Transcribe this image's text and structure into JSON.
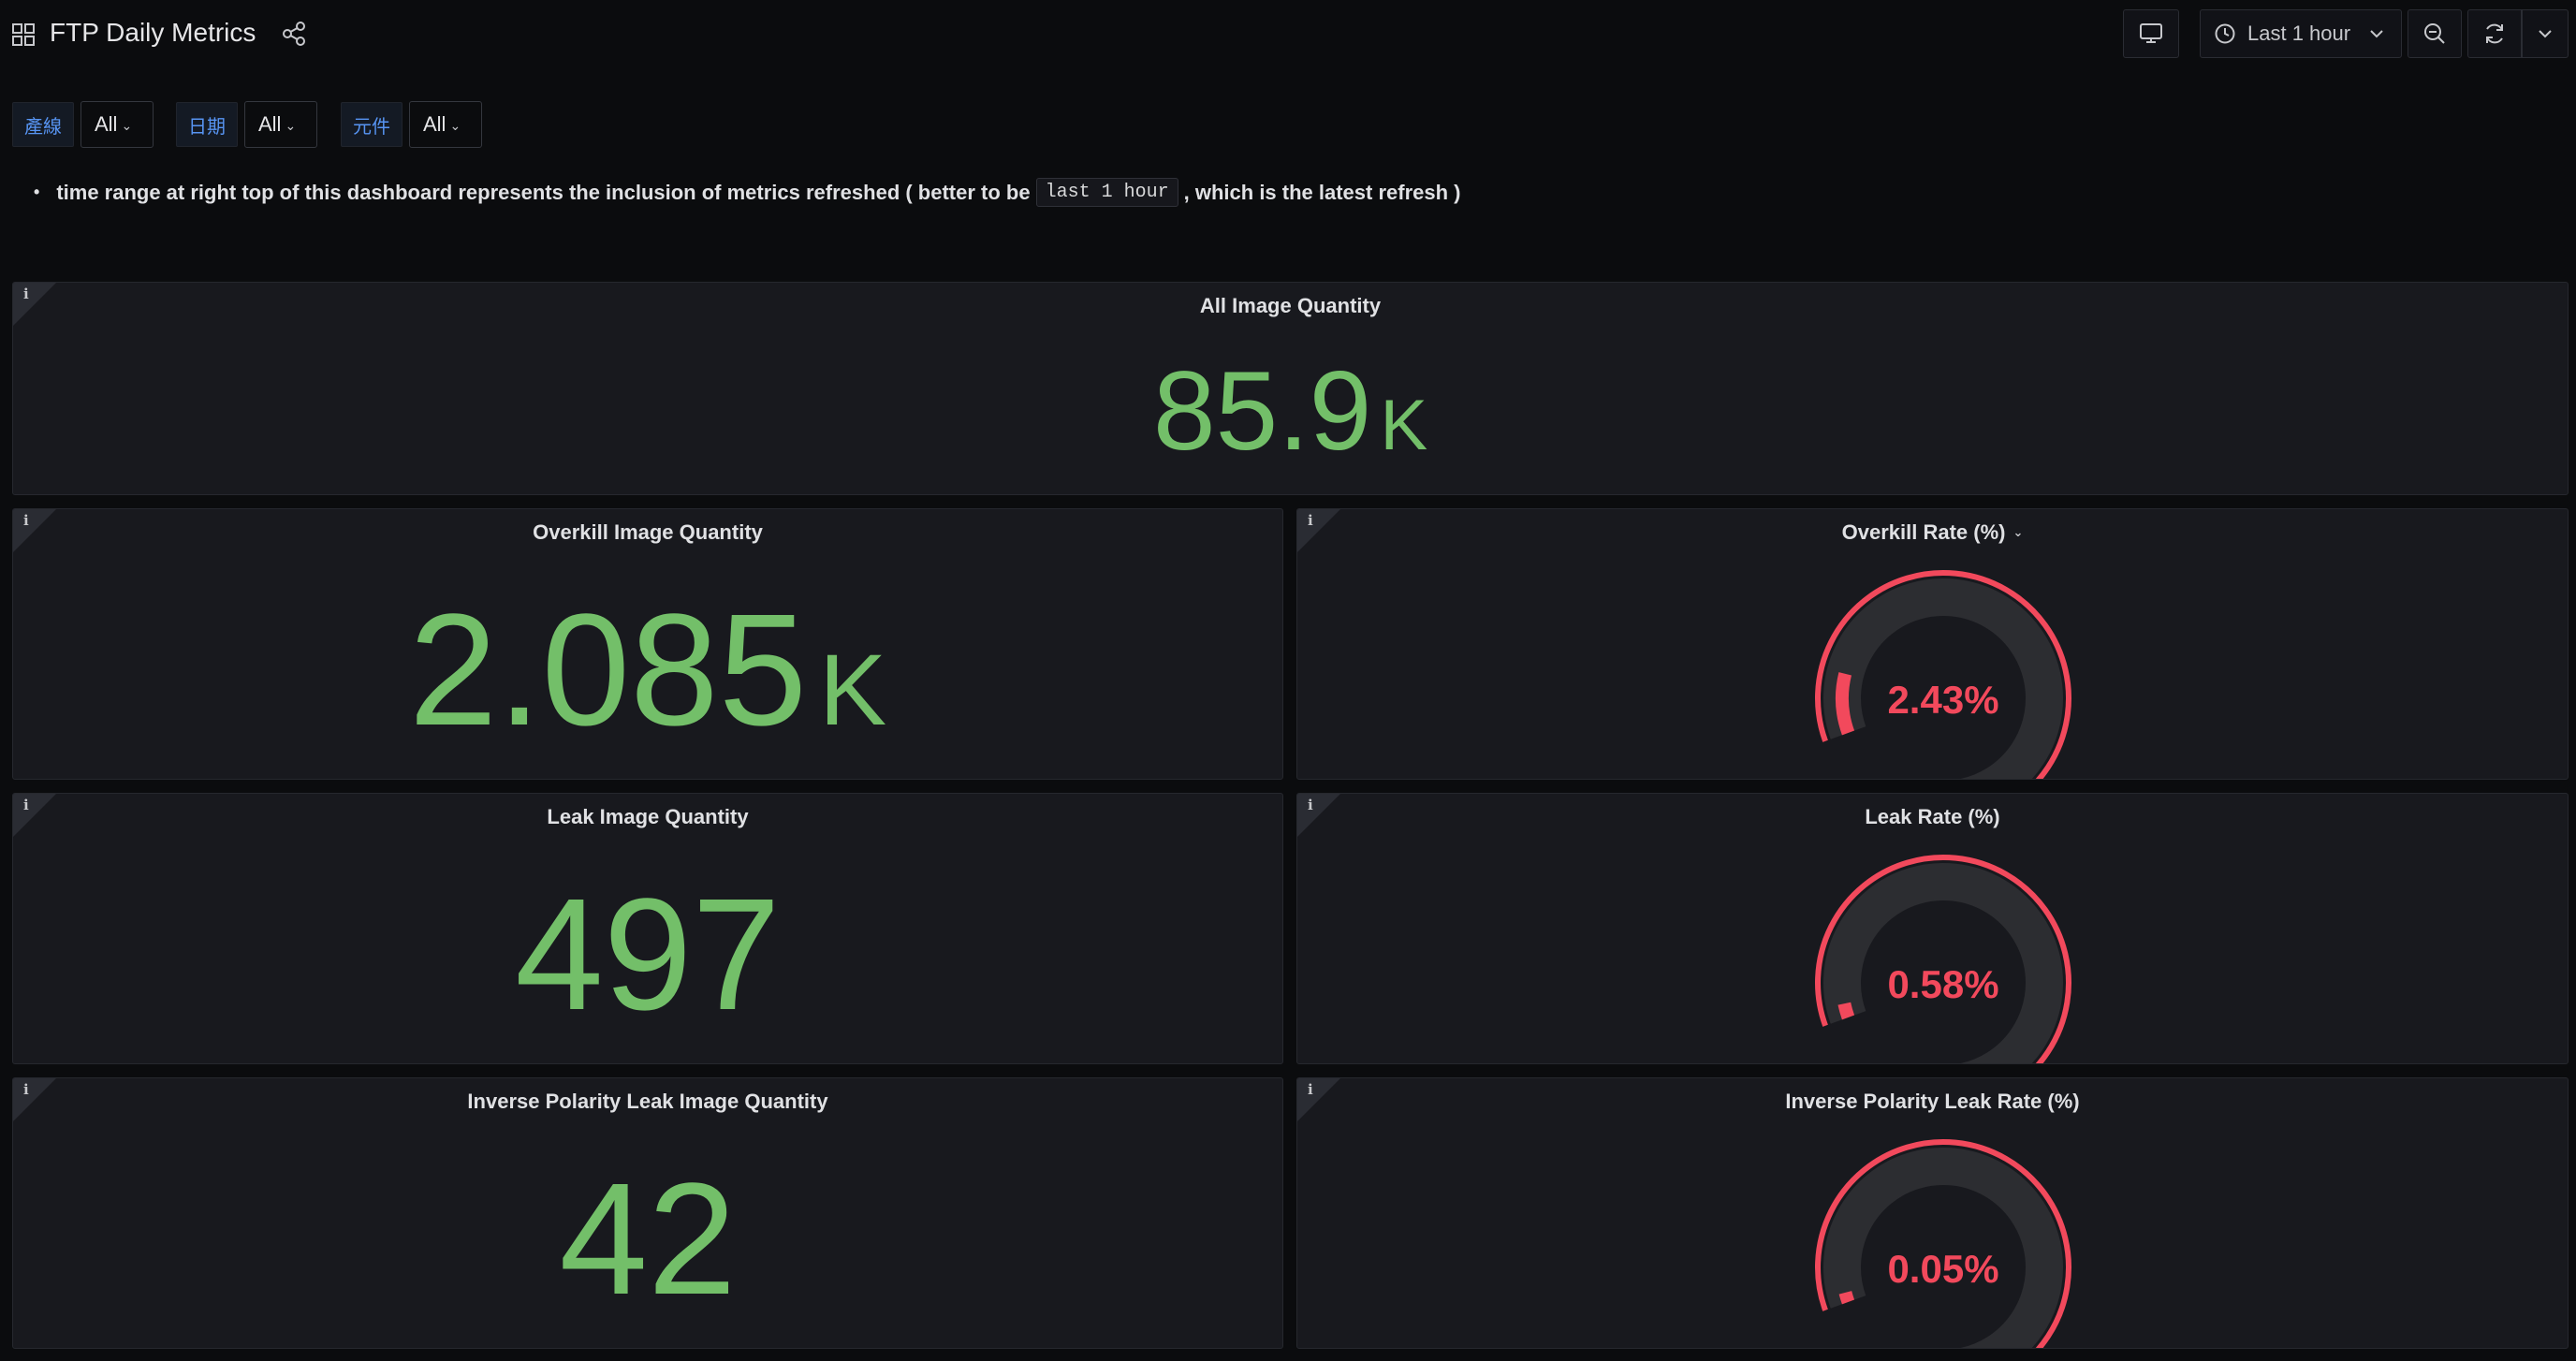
{
  "header": {
    "title": "FTP Daily Metrics",
    "time_range": "Last 1 hour"
  },
  "variables": [
    {
      "label": "產線",
      "value": "All"
    },
    {
      "label": "日期",
      "value": "All"
    },
    {
      "label": "元件",
      "value": "All"
    }
  ],
  "note": {
    "text_before": "time range at right top of this dashboard represents the inclusion of metrics refreshed ( better to be ",
    "code": "last 1 hour",
    "text_after": ", which is the latest refresh )"
  },
  "panels": {
    "all_image": {
      "title": "All Image Quantity",
      "value": "85.9",
      "unit": "K"
    },
    "overkill_image": {
      "title": "Overkill Image Quantity",
      "value": "2.085",
      "unit": "K"
    },
    "overkill_rate": {
      "title": "Overkill Rate (%)",
      "value": "2.43%",
      "fraction": 0.0243
    },
    "leak_image": {
      "title": "Leak Image Quantity",
      "value": "497"
    },
    "leak_rate": {
      "title": "Leak Rate (%)",
      "value": "0.58%",
      "fraction": 0.0058
    },
    "inverse_image": {
      "title": "Inverse Polarity Leak Image Quantity",
      "value": "42"
    },
    "inverse_rate": {
      "title": "Inverse Polarity Leak Rate (%)",
      "value": "0.05%",
      "fraction": 0.0005
    }
  },
  "colors": {
    "stat_green": "#73bf69",
    "gauge_red": "#f2495c",
    "gauge_track": "#2c2d31",
    "background": "#0b0c0e",
    "panel": "#18191e"
  },
  "icons": [
    "apps-icon",
    "share-icon",
    "tv-icon",
    "clock-icon",
    "chevron-down-icon",
    "zoom-out-icon",
    "refresh-icon",
    "info-icon"
  ]
}
